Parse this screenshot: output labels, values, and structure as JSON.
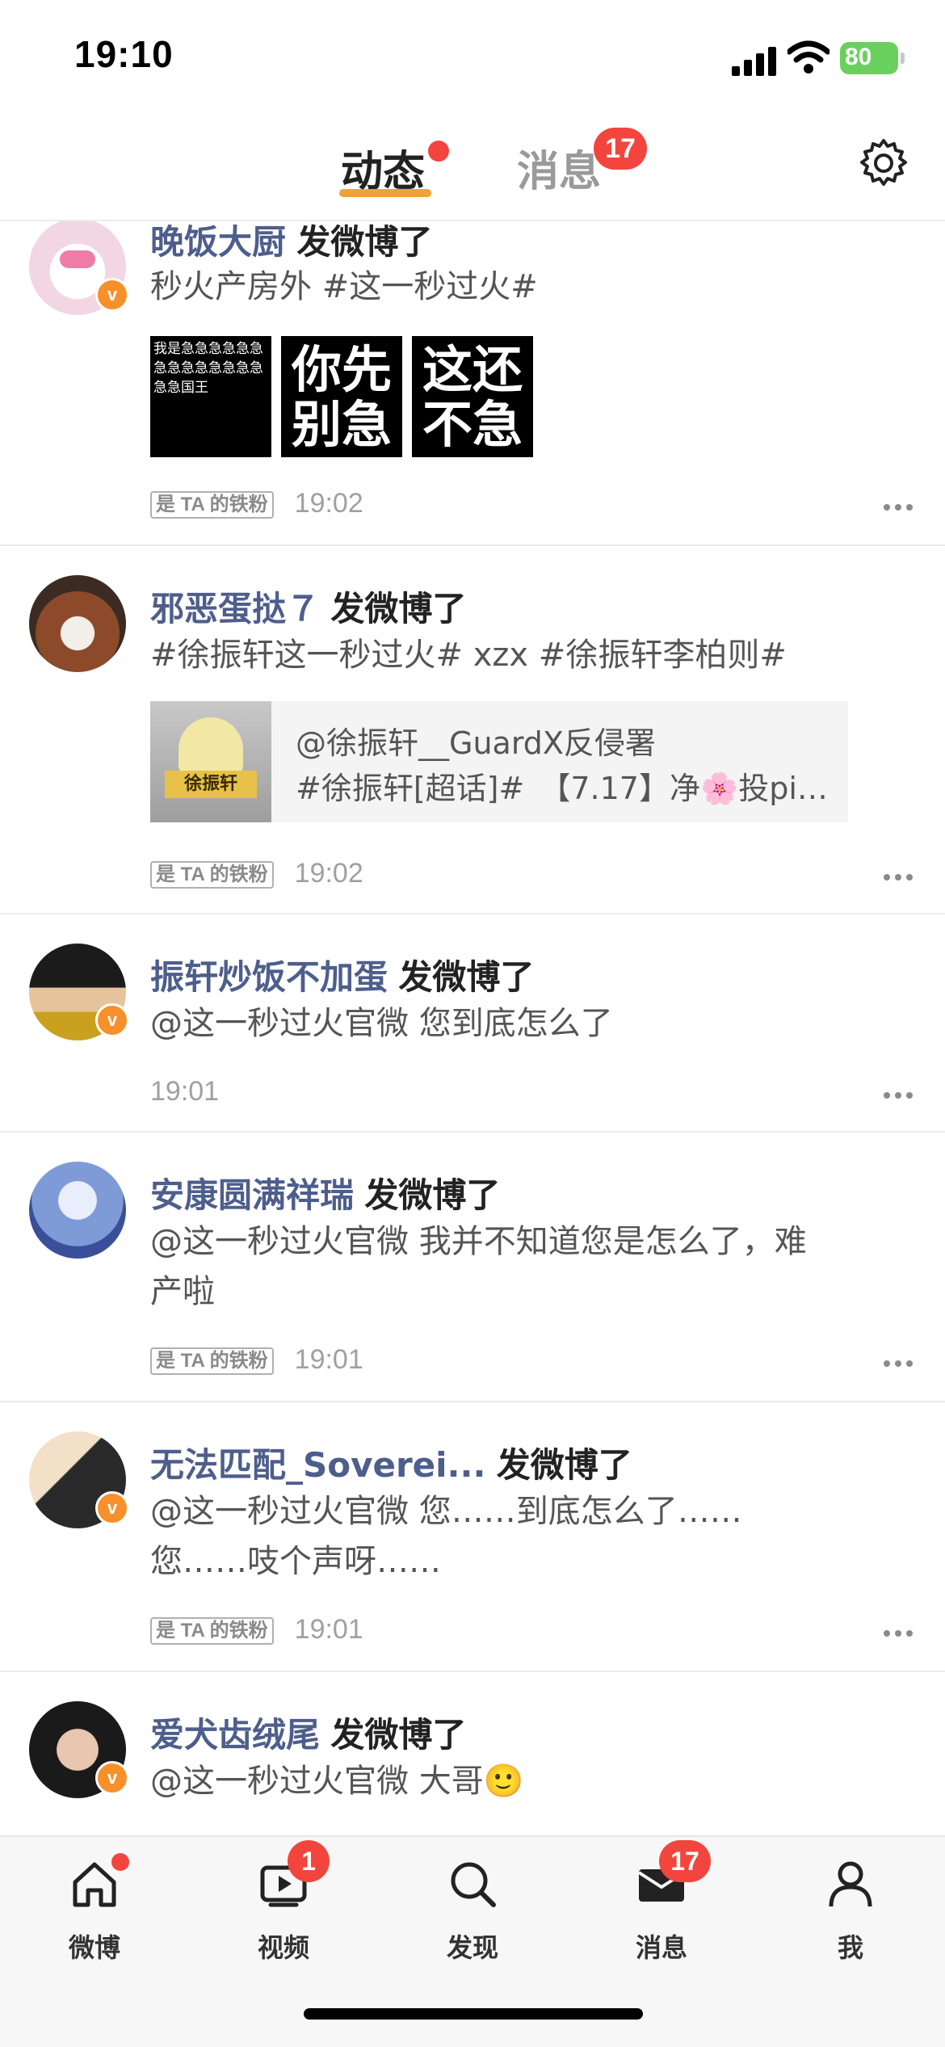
{
  "status_bar": {
    "time": "19:10",
    "battery": "80"
  },
  "top_nav": {
    "tabs": [
      {
        "label": "动态"
      },
      {
        "label": "消息"
      }
    ],
    "messages_badge": "17"
  },
  "feed": [
    {
      "user": "晚饭大厨",
      "action": "发微博了",
      "text": "秒火产房外 #这一秒过火#",
      "images": [
        "我是急急急急急急急急急急急急急急急急国王",
        "你先别急",
        "这还不急"
      ],
      "fan_tag": "是 TA 的铁粉",
      "time": "19:02"
    },
    {
      "user": "邪恶蛋挞７",
      "action": "发微博了",
      "text": "#徐振轩这一秒过火# xzx #徐振轩李柏则#",
      "card": {
        "thumb_label": "徐振轩",
        "line1": "@徐振轩__GuardX反侵署",
        "line2": "#徐振轩[超话]#　【7.17】净🌸投pi…"
      },
      "fan_tag": "是 TA 的铁粉",
      "time": "19:02"
    },
    {
      "user": "振轩炒饭不加蛋",
      "action": "发微博了",
      "text": "@这一秒过火官微 您到底怎么了",
      "time": "19:01"
    },
    {
      "user": "安康圆满祥瑞",
      "action": "发微博了",
      "text_lines": [
        "@这一秒过火官微 我并不知道您是怎么了，难",
        "产啦"
      ],
      "fan_tag": "是 TA 的铁粉",
      "time": "19:01"
    },
    {
      "user": "无法匹配_Soverei...",
      "action": "发微博了",
      "text_lines": [
        "@这一秒过火官微 您……到底怎么了……",
        "您……吱个声呀……"
      ],
      "fan_tag": "是 TA 的铁粉",
      "time": "19:01"
    },
    {
      "user": "爱犬齿绒尾",
      "action": "发微博了",
      "text": "@这一秒过火官微 大哥🙂"
    }
  ],
  "tab_bar": {
    "items": [
      {
        "label": "微博",
        "icon": "home-icon"
      },
      {
        "label": "视频",
        "icon": "video-icon",
        "badge": "1"
      },
      {
        "label": "发现",
        "icon": "search-icon"
      },
      {
        "label": "消息",
        "icon": "mail-icon",
        "badge": "17"
      },
      {
        "label": "我",
        "icon": "profile-icon"
      }
    ]
  },
  "colors": {
    "accent": "#f0a23a",
    "badge": "#f2453d",
    "username": "#4e5e8c",
    "verified": "#f78f2a"
  }
}
